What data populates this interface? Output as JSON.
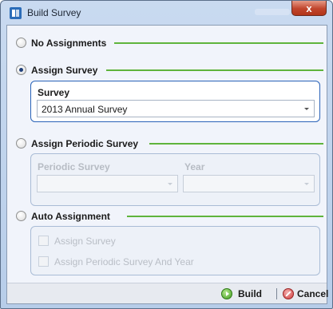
{
  "window": {
    "title": "Build Survey",
    "icon": "app-icon",
    "close_icon": "close-icon",
    "close_glyph": "x"
  },
  "options": {
    "no_assignments": {
      "label": "No Assignments",
      "checked": false
    },
    "assign_survey": {
      "label": "Assign Survey",
      "checked": true
    },
    "assign_periodic": {
      "label": "Assign Periodic Survey",
      "checked": false
    },
    "auto_assignment": {
      "label": "Auto Assignment",
      "checked": false
    }
  },
  "assign_survey_panel": {
    "survey_label": "Survey",
    "survey_value": "2013 Annual Survey"
  },
  "periodic_panel": {
    "periodic_label": "Periodic Survey",
    "year_label": "Year",
    "periodic_value": "",
    "year_value": ""
  },
  "auto_panel": {
    "assign_survey_check": "Assign Survey",
    "assign_periodic_check": "Assign Periodic Survey And Year"
  },
  "footer": {
    "build_label": "Build",
    "cancel_label": "Cancel",
    "build_icon": "play-icon",
    "cancel_icon": "cancel-icon"
  },
  "colors": {
    "accent_rule": "#5fb43c",
    "active_border": "#2a63b8",
    "window_frame": "#c9daf0"
  }
}
